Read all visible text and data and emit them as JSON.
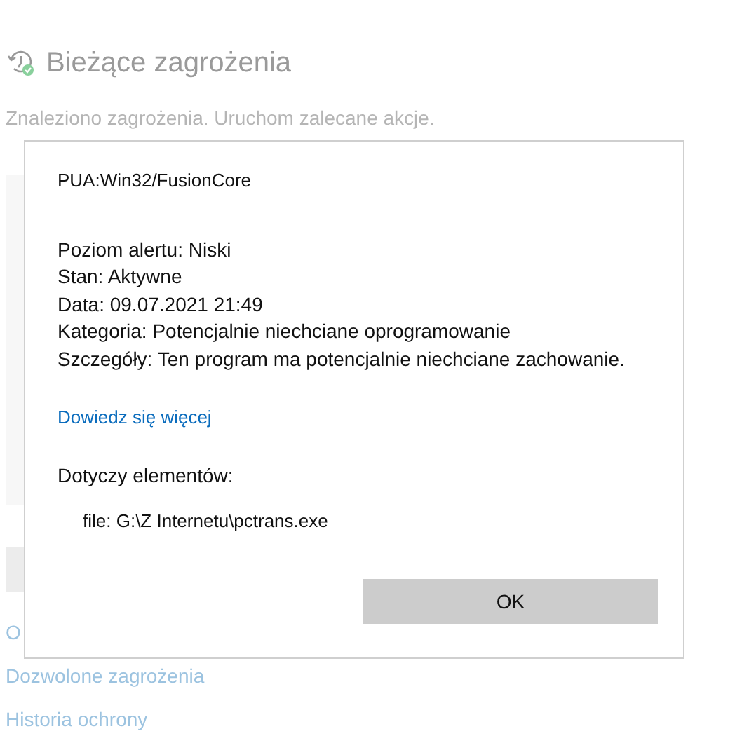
{
  "page": {
    "title": "Bieżące zagrożenia",
    "subtitle": "Znaleziono zagrożenia. Uruchom zalecane akcje.",
    "links": [
      "O",
      "Dozwolone zagrożenia",
      "Historia ochrony"
    ]
  },
  "dialog": {
    "threat_name": "PUA:Win32/FusionCore",
    "details": [
      {
        "label": "Poziom alertu:",
        "value": "Niski"
      },
      {
        "label": "Stan:",
        "value": "Aktywne"
      },
      {
        "label": "Data:",
        "value": "09.07.2021 21:49"
      },
      {
        "label": "Kategoria:",
        "value": "Potencjalnie niechciane oprogramowanie"
      },
      {
        "label": "Szczegóły:",
        "value": "Ten program ma potencjalnie niechciane zachowanie."
      }
    ],
    "learn_more": "Dowiedz się więcej",
    "affected_heading": "Dotyczy elementów:",
    "affected_items": [
      "file: G:\\Z Internetu\\pctrans.exe"
    ],
    "button": "OK"
  }
}
